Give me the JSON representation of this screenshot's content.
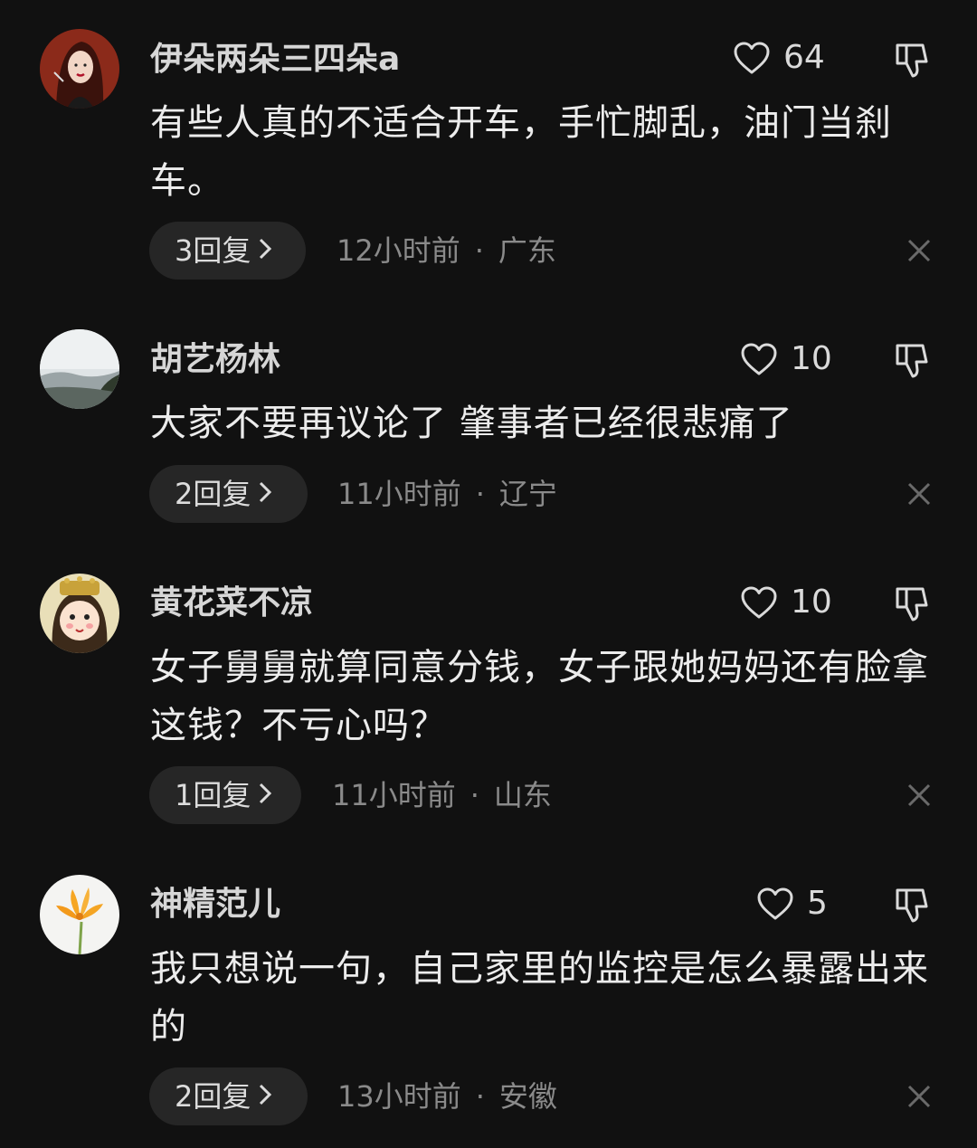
{
  "comments": [
    {
      "username": "伊朵两朵三四朵a",
      "likes": "64",
      "text": "有些人真的不适合开车，手忙脚乱，油门当刹车。",
      "reply_label": "3回复",
      "time": "12小时前",
      "location": "广东",
      "avatar_icon": "woman-portrait-avatar"
    },
    {
      "username": "胡艺杨林",
      "likes": "10",
      "text": "大家不要再议论了 肇事者已经很悲痛了",
      "reply_label": "2回复",
      "time": "11小时前",
      "location": "辽宁",
      "avatar_icon": "landscape-avatar"
    },
    {
      "username": "黄花菜不凉",
      "likes": "10",
      "text": "女子舅舅就算同意分钱，女子跟她妈妈还有脸拿这钱？不亏心吗？",
      "reply_label": "1回复",
      "time": "11小时前",
      "location": "山东",
      "avatar_icon": "cartoon-character-avatar"
    },
    {
      "username": "神精范儿",
      "likes": "5",
      "text": "我只想说一句，自己家里的监控是怎么暴露出来的",
      "reply_label": "2回复",
      "time": "13小时前",
      "location": "安徽",
      "avatar_icon": "flower-avatar"
    }
  ],
  "meta_separator": "·",
  "colors": {
    "background": "#111111",
    "reply_button_bg": "#262626",
    "meta_text": "#8a8a8a"
  }
}
